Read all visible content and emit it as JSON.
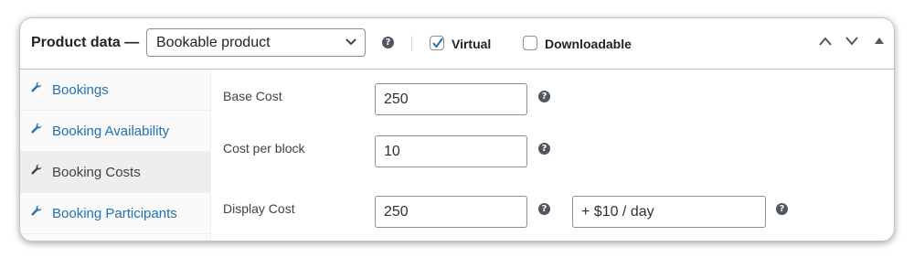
{
  "header": {
    "title": "Product data —",
    "product_type": "Bookable product",
    "help": "?",
    "virtual": {
      "label": "Virtual",
      "checked": true
    },
    "downloadable": {
      "label": "Downloadable",
      "checked": false
    }
  },
  "tabs": [
    {
      "label": "Bookings",
      "active": false
    },
    {
      "label": "Booking Availability",
      "active": false
    },
    {
      "label": "Booking Costs",
      "active": true
    },
    {
      "label": "Booking Participants",
      "active": false
    }
  ],
  "fields": {
    "base_cost": {
      "label": "Base Cost",
      "value": "250"
    },
    "cost_per_block": {
      "label": "Cost per block",
      "value": "10"
    },
    "display_cost": {
      "label": "Display Cost",
      "value": "250",
      "suffix": "+ $10 / day"
    }
  },
  "colors": {
    "link": "#2271b1",
    "checkbox_check": "#2271b1",
    "active_tab": "#eeeeee"
  }
}
